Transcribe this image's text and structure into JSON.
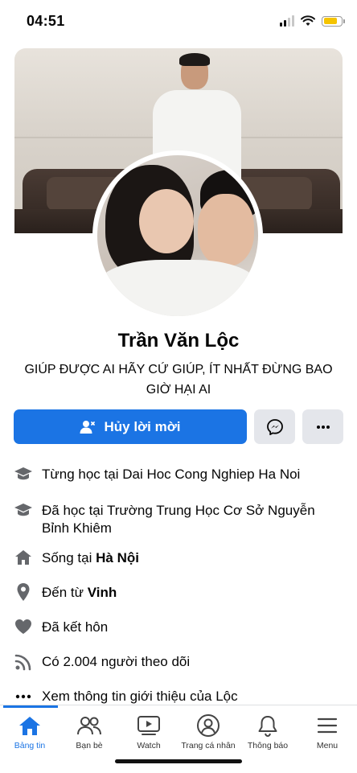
{
  "status_bar": {
    "time": "04:51"
  },
  "profile": {
    "name": "Trần Văn Lộc",
    "bio": "GIÚP ĐƯỢC AI HÃY CỨ GIÚP, ÍT NHẤT ĐỪNG BAO GIỜ HẠI AI"
  },
  "actions": {
    "primary_label": "Hủy lời mời",
    "primary_color": "#1b74e4",
    "message_icon": "messenger-icon",
    "more_icon": "more-horizontal-icon"
  },
  "info": [
    {
      "icon": "graduation-cap-icon",
      "prefix": "Từng học tại ",
      "bold": "",
      "suffix": "Dai Hoc Cong Nghiep Ha Noi"
    },
    {
      "icon": "graduation-cap-icon",
      "prefix": "Đã học tại ",
      "bold": "",
      "suffix": "Trường Trung Học Cơ Sở Nguyễn Bỉnh Khiêm"
    },
    {
      "icon": "home-icon",
      "prefix": "Sống tại ",
      "bold": "Hà Nội",
      "suffix": ""
    },
    {
      "icon": "location-pin-icon",
      "prefix": "Đến từ ",
      "bold": "Vinh",
      "suffix": ""
    },
    {
      "icon": "heart-icon",
      "prefix": "Đã kết hôn",
      "bold": "",
      "suffix": ""
    },
    {
      "icon": "rss-feed-icon",
      "prefix": "Có 2.004 người theo dõi",
      "bold": "",
      "suffix": ""
    },
    {
      "icon": "ellipsis-icon",
      "prefix": "Xem thông tin giới thiệu của Lộc",
      "bold": "",
      "suffix": ""
    }
  ],
  "tabbar": {
    "tabs": [
      {
        "label": "Bảng tin",
        "icon": "home-icon",
        "active": true
      },
      {
        "label": "Bạn bè",
        "icon": "friends-icon",
        "active": false
      },
      {
        "label": "Watch",
        "icon": "video-icon",
        "active": false
      },
      {
        "label": "Trang cá nhân",
        "icon": "profile-icon",
        "active": false
      },
      {
        "label": "Thông báo",
        "icon": "bell-icon",
        "active": false
      },
      {
        "label": "Menu",
        "icon": "menu-icon",
        "active": false
      }
    ]
  }
}
